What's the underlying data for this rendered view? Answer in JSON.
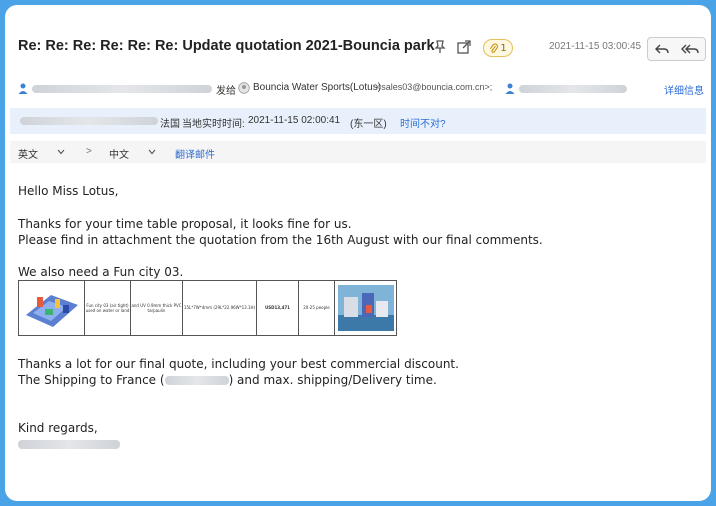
{
  "subject": "Re: Re: Re: Re: Re: Re: Update quotation 2021-Bouncia park",
  "attachment_count": "1",
  "timestamp": "2021-11-15 03:00:45",
  "sender_row": {
    "sent_to_label": "发给",
    "recipient_name": "Bouncia Water Sports(Lotus)",
    "recipient_email": "<sales03@bouncia.com.cn>;",
    "details_link": "详细信息"
  },
  "timezone_bar": {
    "country": "法国",
    "local_time_label": "当地实时时间:",
    "local_time": "2021-11-15 02:00:41",
    "zone": "(东一区)",
    "wrong_time_link": "时间不对?"
  },
  "translate_row": {
    "source_lang": "英文",
    "arrow": ">",
    "target_lang": "中文",
    "translate_link": "翻译邮件"
  },
  "body": {
    "greeting": "Hello Miss Lotus,",
    "line1": "Thanks for your time table proposal, it looks fine for us.",
    "line2": "Please find in attachment the quotation from the 16th August with our final comments.",
    "line3": "We also need a Fun city 03.",
    "line4": "Thanks a lot for our final quote, including your best commercial discount.",
    "line5_a": "The Shipping to France (",
    "line5_b": ") and max. shipping/Delivery time.",
    "closing": "Kind regards,"
  },
  "quote_table": {
    "cells": [
      "Fun city 03 (air tight) used on water or land",
      "and UV 0.9mm thick PVC tarpaulin",
      "15L*7W*4mm (29L*22.96W*13.1H)",
      "USD13,471",
      "20-25 people"
    ]
  },
  "colors": {
    "frame_border": "#4aa3e6",
    "link": "#2b6cd4",
    "timezone_bar": "#e8f1fb"
  }
}
